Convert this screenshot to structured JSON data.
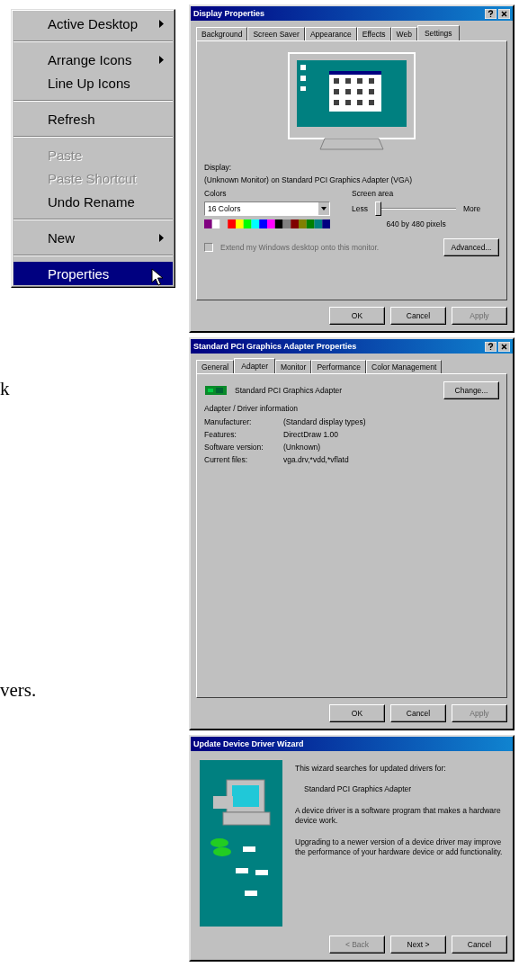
{
  "context_menu": {
    "groups": [
      {
        "items": [
          {
            "label": "Active Desktop",
            "submenu": true,
            "disabled": false,
            "selected": false
          }
        ]
      },
      {
        "items": [
          {
            "label": "Arrange Icons",
            "submenu": true,
            "disabled": false,
            "selected": false
          },
          {
            "label": "Line Up Icons",
            "submenu": false,
            "disabled": false,
            "selected": false
          }
        ]
      },
      {
        "items": [
          {
            "label": "Refresh",
            "submenu": false,
            "disabled": false,
            "selected": false
          }
        ]
      },
      {
        "items": [
          {
            "label": "Paste",
            "submenu": false,
            "disabled": true,
            "selected": false
          },
          {
            "label": "Paste Shortcut",
            "submenu": false,
            "disabled": true,
            "selected": false
          },
          {
            "label": "Undo Rename",
            "submenu": false,
            "disabled": false,
            "selected": false
          }
        ]
      },
      {
        "items": [
          {
            "label": "New",
            "submenu": true,
            "disabled": false,
            "selected": false
          }
        ]
      },
      {
        "items": [
          {
            "label": "Properties",
            "submenu": false,
            "disabled": false,
            "selected": true
          }
        ]
      }
    ]
  },
  "manual_text": [
    "k",
    "vers."
  ],
  "display_properties": {
    "title": "Display Properties",
    "tabs": [
      {
        "label": "Background",
        "selected": false
      },
      {
        "label": "Screen Saver",
        "selected": false
      },
      {
        "label": "Appearance",
        "selected": false
      },
      {
        "label": "Effects",
        "selected": false
      },
      {
        "label": "Web",
        "selected": false
      },
      {
        "label": "Settings",
        "selected": true
      }
    ],
    "display_label": "Display:",
    "display_value": "(Unknown Monitor) on Standard PCI Graphics Adapter (VGA)",
    "colors_label": "Colors",
    "colors_value": "16 Colors",
    "screen_area_label": "Screen area",
    "less": "Less",
    "more": "More",
    "slider": {
      "level": 0
    },
    "resolution": "640 by 480 pixels",
    "extend_checkbox": {
      "label": "Extend my Windows desktop onto this monitor.",
      "checked": false,
      "disabled": true
    },
    "advanced_button": "Advanced...",
    "buttons": [
      {
        "label": "OK",
        "disabled": false
      },
      {
        "label": "Cancel",
        "disabled": false
      },
      {
        "label": "Apply",
        "disabled": true
      }
    ]
  },
  "adapter_properties": {
    "title": "Standard PCI Graphics Adapter Properties",
    "tabs": [
      {
        "label": "General",
        "selected": false
      },
      {
        "label": "Adapter",
        "selected": true
      },
      {
        "label": "Monitor",
        "selected": false
      },
      {
        "label": "Performance",
        "selected": false
      },
      {
        "label": "Color Management",
        "selected": false
      }
    ],
    "adapter_name": "Standard PCI Graphics Adapter",
    "change_button": "Change...",
    "info_heading": "Adapter / Driver information",
    "info": [
      {
        "label": "Manufacturer:",
        "value": "(Standard display types)"
      },
      {
        "label": "Features:",
        "value": "DirectDraw 1.00"
      },
      {
        "label": "Software version:",
        "value": "(Unknown)"
      },
      {
        "label": "Current files:",
        "value": "vga.drv,*vdd,*vflatd"
      }
    ],
    "buttons": [
      {
        "label": "OK",
        "disabled": false
      },
      {
        "label": "Cancel",
        "disabled": false
      },
      {
        "label": "Apply",
        "disabled": true
      }
    ]
  },
  "update_wizard": {
    "title": "Update Device Driver Wizard",
    "paragraphs": [
      {
        "text": "This wizard searches for updated drivers for:",
        "indent": false
      },
      {
        "text": "Standard PCI Graphics Adapter",
        "indent": true
      },
      {
        "text": "A device driver is a software program that makes a hardware device work.",
        "indent": false
      },
      {
        "text": "Upgrading to a newer version of a device driver may improve the performance of your hardware device or add functionality.",
        "indent": false
      }
    ],
    "buttons": [
      {
        "label": "< Back",
        "disabled": true
      },
      {
        "label": "Next >",
        "disabled": false
      },
      {
        "label": "Cancel",
        "disabled": false
      }
    ]
  }
}
